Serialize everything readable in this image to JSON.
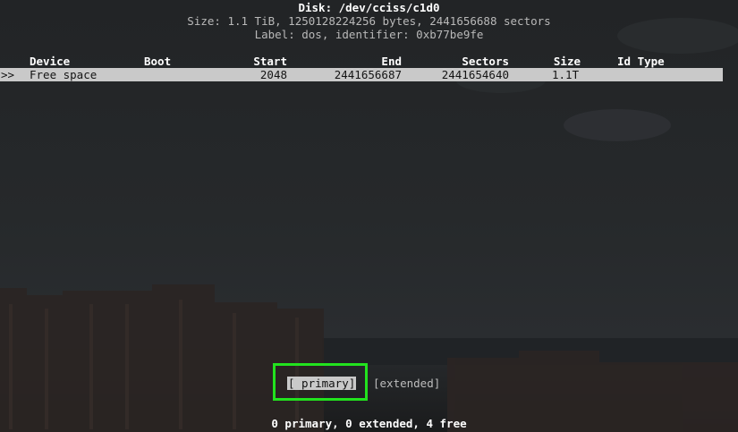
{
  "disk": {
    "title": "Disk: /dev/cciss/c1d0",
    "size_line": "Size: 1.1 TiB, 1250128224256 bytes, 2441656688 sectors",
    "label_line": "Label: dos, identifier: 0xb77be9fe"
  },
  "table": {
    "headers": {
      "device": "Device",
      "boot": "Boot",
      "start": "Start",
      "end": "End",
      "sectors": "Sectors",
      "size": "Size",
      "id_type": "Id Type"
    },
    "rows": [
      {
        "marker": ">>",
        "device": "Free space",
        "boot": "",
        "start": "2048",
        "end": "2441656687",
        "sectors": "2441654640",
        "size": "1.1T",
        "id_type": ""
      }
    ]
  },
  "menu": {
    "primary_label": "[ primary]",
    "extended_label": "[extended]",
    "selected": "primary",
    "highlight_color": "#22e31e"
  },
  "status": {
    "text": "0 primary, 0 extended, 4 free"
  }
}
